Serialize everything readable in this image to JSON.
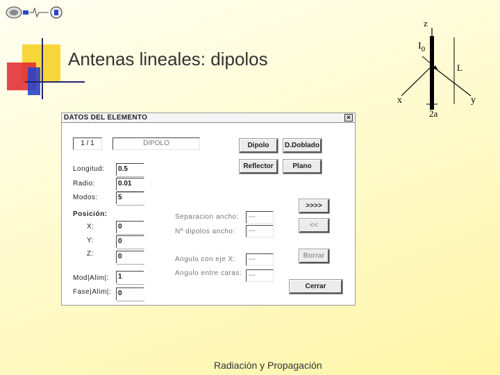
{
  "slide": {
    "title": "Antenas lineales: dipolos",
    "footer": "Radiación y Propagación"
  },
  "diagram": {
    "z_label": "z",
    "current_label": "I",
    "current_subscript": "0",
    "length_label": "L",
    "x_label": "x",
    "y_label": "y",
    "radius_label": "2a"
  },
  "dialog": {
    "title": "DATOS DEL ELEMENTO",
    "close_label": "×",
    "counter": "1 / 1",
    "element_type": "DIPOLO",
    "buttons": {
      "dipolo": "Dipolo",
      "d_doblado": "D.Doblado",
      "reflector": "Reflector",
      "plano": "Plano",
      "next": ">>>>",
      "prev": "<<",
      "borrar": "Borrar",
      "cerrar": "Cerrar"
    },
    "labels": {
      "longitud": "Longitud:",
      "radio": "Radio:",
      "modos": "Modos:",
      "posicion": "Posición:",
      "x": "X:",
      "y": "Y:",
      "z": "Z:",
      "mod_alim": "Mod|Alim|:",
      "fase_alim": "Fase|Alim|:",
      "separacion_ancho": "Separacion ancho:",
      "n_dipolos_ancho": "Nº dipolos ancho:",
      "angulo_eje_x": "Angulo con eje X:",
      "angulo_caras": "Angulo entre caras:"
    },
    "values": {
      "longitud": "0.5",
      "radio": "0.01",
      "modos": "5",
      "x": "0",
      "y": "0",
      "z": "0",
      "mod_alim": "1",
      "fase_alim": "0",
      "separacion_ancho": "---",
      "n_dipolos_ancho": "---",
      "angulo_eje_x": "---",
      "angulo_caras": "---"
    }
  },
  "colors": {
    "accent_yellow": "#f7d63a",
    "accent_red": "#e0262e",
    "accent_blue": "#2b45c8",
    "line_navy": "#23236e"
  }
}
